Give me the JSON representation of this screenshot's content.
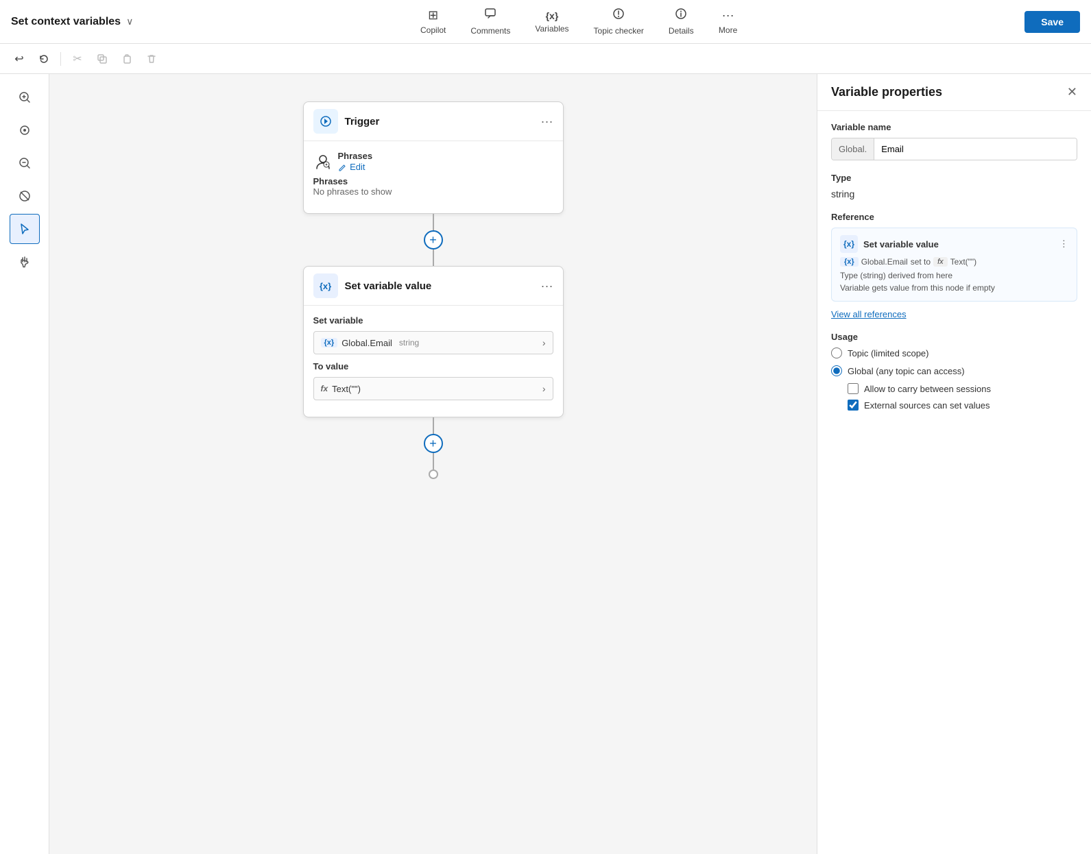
{
  "topbar": {
    "title": "Set context variables",
    "nav": [
      {
        "id": "copilot",
        "label": "Copilot",
        "icon": "⊞"
      },
      {
        "id": "comments",
        "label": "Comments",
        "icon": "💬"
      },
      {
        "id": "variables",
        "label": "Variables",
        "icon": "{x}"
      },
      {
        "id": "topic_checker",
        "label": "Topic checker",
        "icon": "🩺"
      },
      {
        "id": "details",
        "label": "Details",
        "icon": "ℹ"
      },
      {
        "id": "more",
        "label": "More",
        "icon": "···"
      }
    ],
    "save_label": "Save"
  },
  "toolbar": {
    "undo_label": "↩",
    "redo_label": "˅",
    "cut_label": "✂",
    "copy_label": "⧉",
    "paste_label": "⎘",
    "delete_label": "🗑"
  },
  "flow": {
    "trigger_node": {
      "title": "Trigger",
      "phrases_label": "Phrases",
      "edit_label": "Edit",
      "no_phrases": "No phrases to show"
    },
    "set_variable_node": {
      "title": "Set variable value",
      "set_var_label": "Set variable",
      "var_tag": "{x}",
      "var_name": "Global.Email",
      "var_type": "string",
      "to_value_label": "To value",
      "fx_tag": "fx",
      "fx_value": "Text(\"\")"
    }
  },
  "panel": {
    "title": "Variable properties",
    "variable_name_section": "Variable name",
    "var_prefix": "Global.",
    "var_name_value": "Email",
    "type_section": "Type",
    "type_value": "string",
    "reference_section": "Reference",
    "ref_card": {
      "title": "Set variable value",
      "var_tag": "{x}",
      "var_name": "Global.Email",
      "set_to_text": "set to",
      "fx_tag": "fx",
      "fx_value": "Text(\"\")",
      "note_line1": "Type (string) derived from here",
      "note_line2": "Variable gets value from this node if empty"
    },
    "view_all_label": "View all references",
    "usage_section": "Usage",
    "usage_options": [
      {
        "id": "topic",
        "label": "Topic (limited scope)",
        "checked": false
      },
      {
        "id": "global",
        "label": "Global (any topic can access)",
        "checked": true
      }
    ],
    "checkboxes": [
      {
        "id": "carry",
        "label": "Allow to carry between sessions",
        "checked": false
      },
      {
        "id": "external",
        "label": "External sources can set values",
        "checked": true
      }
    ]
  },
  "side_tools": [
    {
      "id": "zoom-in",
      "icon": "🔍+",
      "label": "zoom-in"
    },
    {
      "id": "center",
      "icon": "⊙",
      "label": "center-view"
    },
    {
      "id": "zoom-out",
      "icon": "🔍-",
      "label": "zoom-out"
    },
    {
      "id": "no-touch",
      "icon": "🚫",
      "label": "no-touch"
    },
    {
      "id": "cursor",
      "icon": "↖",
      "label": "select-tool",
      "active": true
    },
    {
      "id": "hand",
      "icon": "✋",
      "label": "pan-tool"
    }
  ]
}
